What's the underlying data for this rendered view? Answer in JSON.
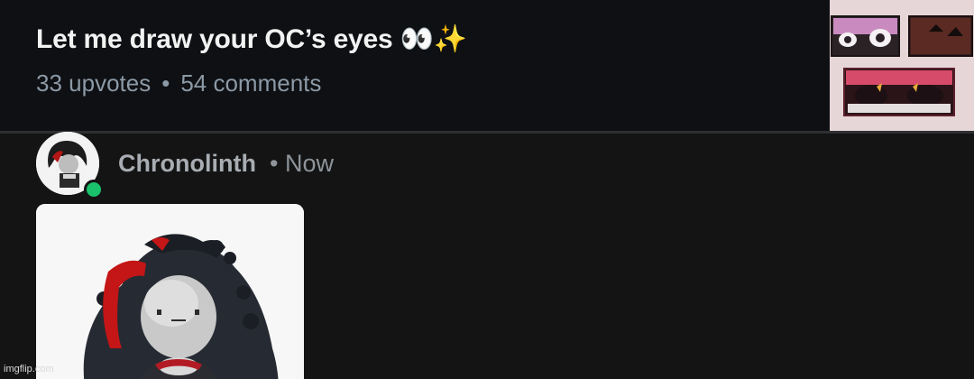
{
  "post": {
    "title": "Let me draw your OC’s eyes 👀✨",
    "upvotes": "33 upvotes",
    "separator": "•",
    "comments": "54 comments"
  },
  "comment": {
    "author": "Chronolinth",
    "time": "• Now",
    "online_color": "#19c26b"
  },
  "watermark": "imgflip.com"
}
